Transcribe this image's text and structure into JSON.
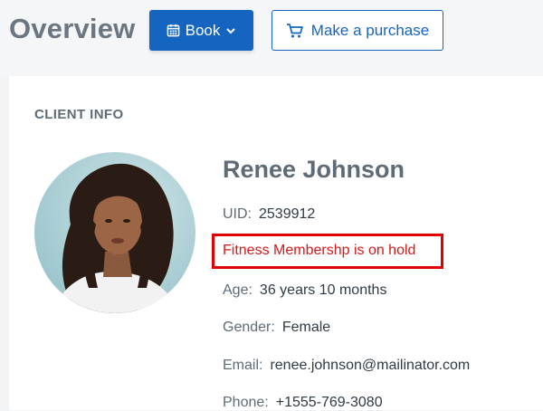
{
  "header": {
    "title": "Overview",
    "book_label": "Book",
    "purchase_label": "Make a purchase"
  },
  "client": {
    "section_label": "CLIENT INFO",
    "name": "Renee Johnson",
    "uid_label": "UID:",
    "uid": "2539912",
    "status_alert": "Fitness Membershp is on hold",
    "age_label": "Age:",
    "age": "36 years 10 months",
    "gender_label": "Gender:",
    "gender": "Female",
    "email_label": "Email:",
    "email": "renee.johnson@mailinator.com",
    "phone_label": "Phone:",
    "phone": "+1555-769-3080"
  },
  "icons": {
    "book": "calendar-icon",
    "book_dropdown": "chevron-down-icon",
    "purchase": "cart-icon"
  },
  "colors": {
    "primary": "#1565c0",
    "alert": "#e00000",
    "text": "#5f6b76"
  }
}
